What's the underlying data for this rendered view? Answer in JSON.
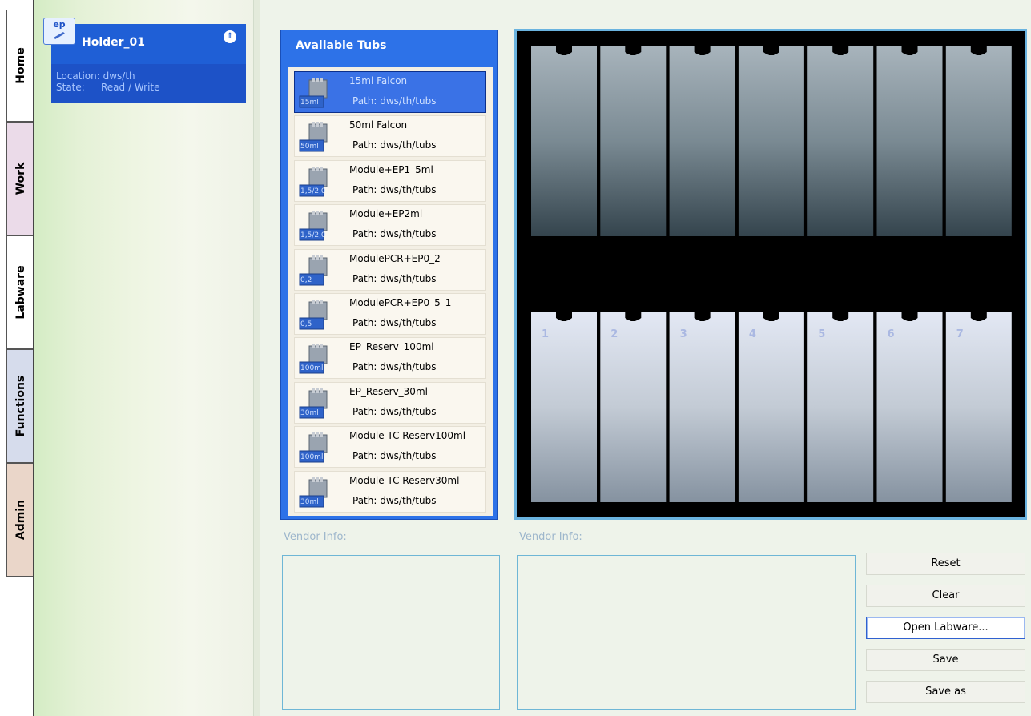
{
  "tabs": [
    {
      "label": "Home"
    },
    {
      "label": "Work"
    },
    {
      "label": "Labware"
    },
    {
      "label": "Functions"
    },
    {
      "label": "Admin"
    }
  ],
  "holder": {
    "icon_text": "ep",
    "title": "Holder_01",
    "location_label": "Location:",
    "location_value": "dws/th",
    "state_label": "State:",
    "state_value": "Read / Write"
  },
  "tubs_panel": {
    "title": "Available Tubs",
    "items": [
      {
        "name": "15ml Falcon",
        "path": "Path: dws/th/tubs",
        "icon": "15ml",
        "selected": true
      },
      {
        "name": "50ml Falcon",
        "path": "Path: dws/th/tubs",
        "icon": "50ml"
      },
      {
        "name": "Module+EP1_5ml",
        "path": "Path: dws/th/tubs",
        "icon": "1,5/2,0"
      },
      {
        "name": "Module+EP2ml",
        "path": "Path: dws/th/tubs",
        "icon": "1,5/2,0"
      },
      {
        "name": "ModulePCR+EP0_2",
        "path": "Path: dws/th/tubs",
        "icon": "0,2"
      },
      {
        "name": "ModulePCR+EP0_5_1",
        "path": "Path: dws/th/tubs",
        "icon": "0,5"
      },
      {
        "name": "EP_Reserv_100ml",
        "path": "Path: dws/th/tubs",
        "icon": "100ml"
      },
      {
        "name": "EP_Reserv_30ml",
        "path": "Path: dws/th/tubs",
        "icon": "30ml"
      },
      {
        "name": "Module TC Reserv100ml",
        "path": "Path: dws/th/tubs",
        "icon": "100ml"
      },
      {
        "name": "Module TC Reserv30ml",
        "path": "Path: dws/th/tubs",
        "icon": "30ml"
      }
    ]
  },
  "preview": {
    "slot_numbers": [
      "1",
      "2",
      "3",
      "4",
      "5",
      "6",
      "7"
    ]
  },
  "vendor_info_left": {
    "label": "Vendor Info:"
  },
  "vendor_info_right": {
    "label": "Vendor Info:"
  },
  "buttons": {
    "reset": "Reset",
    "clear": "Clear",
    "open_labware": "Open Labware...",
    "save": "Save",
    "save_as": "Save as"
  },
  "colors": {
    "accent": "#1f5fd6",
    "panel_border": "#6ab3df"
  }
}
